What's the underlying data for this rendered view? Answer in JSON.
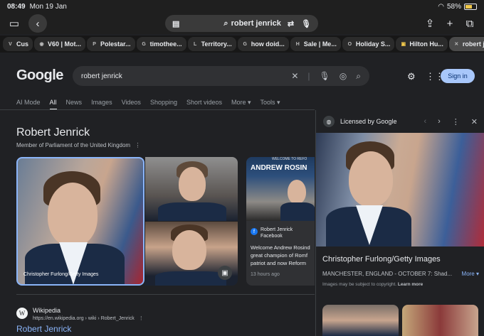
{
  "status": {
    "time": "08:49",
    "date": "Mon 19 Jan",
    "battery": "58%"
  },
  "browser": {
    "url_query": "robert jenrick",
    "tabs": [
      {
        "fav": "V",
        "label": "Cus"
      },
      {
        "fav": "◉",
        "label": "V60 | Mot..."
      },
      {
        "fav": "P",
        "label": "Polestar..."
      },
      {
        "fav": "G",
        "label": "timothee..."
      },
      {
        "fav": "L",
        "label": "Territory..."
      },
      {
        "fav": "G",
        "label": "how doid..."
      },
      {
        "fav": "H",
        "label": "Sale | Me..."
      },
      {
        "fav": "O",
        "label": "Holiday S..."
      },
      {
        "fav": "▣",
        "label": "Hilton Hu..."
      },
      {
        "fav": "✕",
        "label": "robert je..."
      }
    ]
  },
  "google": {
    "logo": "Google",
    "search_value": "robert jenrick",
    "sign_in": "Sign in",
    "nav": [
      "AI Mode",
      "All",
      "News",
      "Images",
      "Videos",
      "Shopping",
      "Short videos",
      "More ▾",
      "Tools ▾"
    ]
  },
  "entity": {
    "title": "Robert Jenrick",
    "subtitle": "Member of Parliament of the United Kingdom",
    "main_caption": "Christopher Furlong/Getty Images",
    "news": {
      "header_welcome": "WELCOME TO REFO",
      "headline": "ANDREW ROSIN",
      "source_name": "Robert Jenrick",
      "source_site": "Facebook",
      "snippet": [
        "Welcome Andrew Rosind",
        "great champion of Romf",
        "patriot and now Reform"
      ],
      "time": "13 hours ago"
    }
  },
  "result": {
    "site": "Wikipedia",
    "url": "https://en.wikipedia.org › wiki › Robert_Jenrick",
    "title": "Robert Jenrick"
  },
  "panel": {
    "license": "Licensed by Google",
    "title": "Christopher Furlong/Getty Images",
    "desc": "MANCHESTER, ENGLAND - OCTOBER 7: Shad...",
    "more": "More ▾",
    "copyright": "Images may be subject to copyright.",
    "learn_more": "Learn more"
  }
}
